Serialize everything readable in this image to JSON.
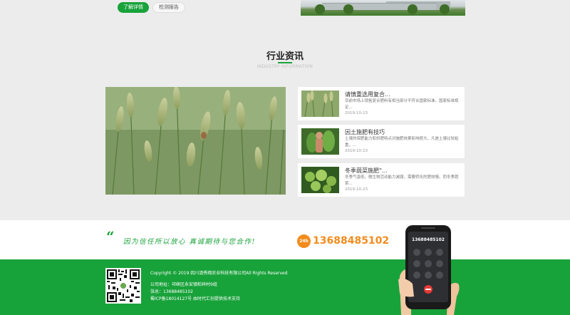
{
  "top": {
    "detail_button": "了解详情",
    "report_button": "检测报告"
  },
  "section": {
    "title": "行业资讯",
    "subtitle": "INDUSTRY INFORMATION"
  },
  "news": [
    {
      "title": "请慎重选用复合...",
      "desc": "目前市场上销售复合肥料有相当部分不符合国家标准。国家标准规定...",
      "date": "2019-10-23"
    },
    {
      "title": "因土施肥有技巧",
      "desc": "土壤的保肥能力和供肥特点对施肥效果影响很大。凡是土壤比较粘重，...",
      "date": "2019-10-23"
    },
    {
      "title": "冬季蔬菜施肥“...",
      "desc": "冬季气温低，微生物活动能力减弱，需要转化的肥效慢。而冬季蔬菜...",
      "date": "2019-10-23"
    }
  ],
  "banner": {
    "quote_mark": "“",
    "slogan": "因为信任所以放心 真诚期待与您合作!",
    "phone_icon_label": "24h",
    "phone_number": "13688485102",
    "screen_number": "13688485102"
  },
  "footer": {
    "copyright": "Copyright © 2019 四川滇秀翔农业科技有限公司All Rights Reserved",
    "address": "公司地址：邛崃区永安镇柏祥村9组",
    "tel": "张总：13688485102",
    "icp": "蜀ICP备18014127号   由时代汇创提供技术支持"
  },
  "colors": {
    "brand_green": "#18a23a",
    "accent_orange": "#f28c1d"
  },
  "icons": [
    "phone-24h-icon",
    "qr-code",
    "quote-icon"
  ]
}
